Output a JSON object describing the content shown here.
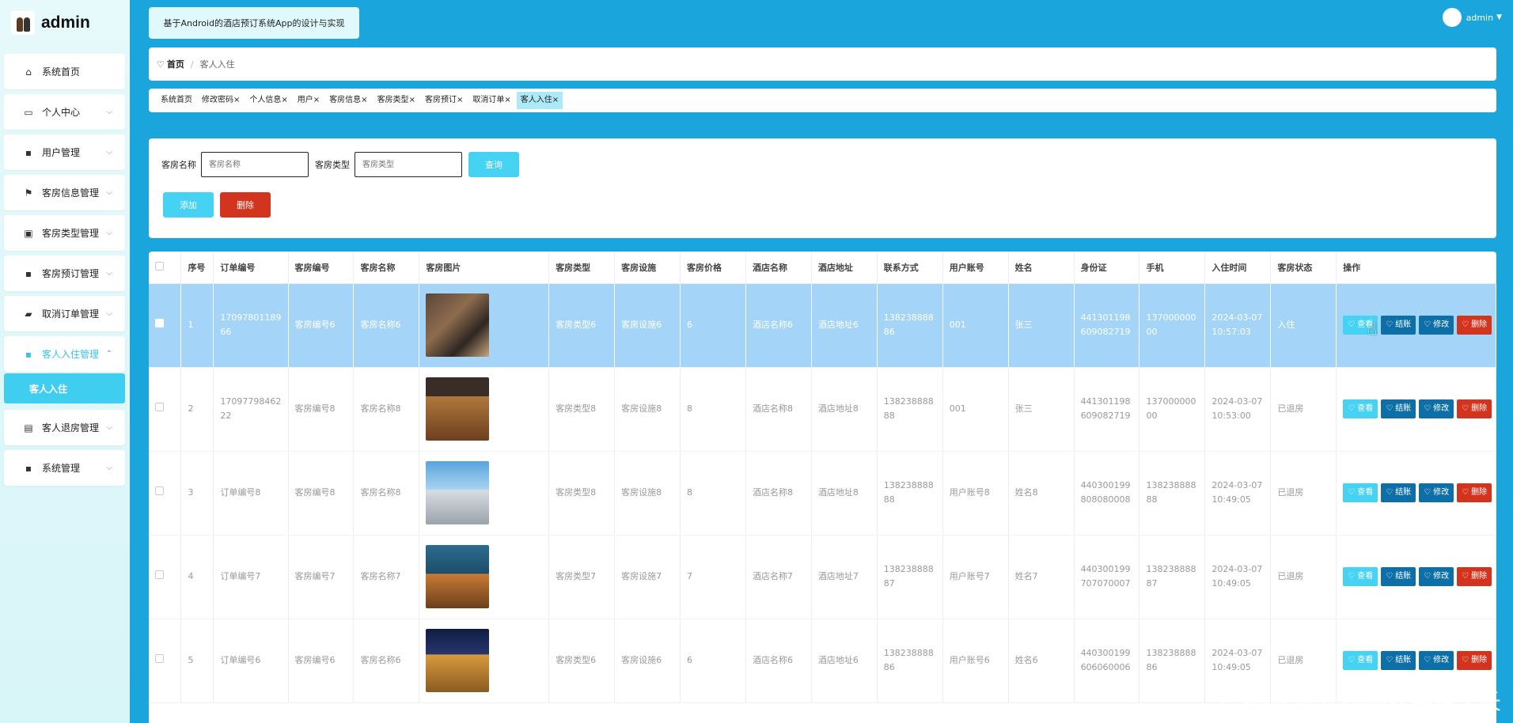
{
  "brand": {
    "title": "admin"
  },
  "sidebar": {
    "items": [
      {
        "label": "系统首页",
        "icon": "home-icon",
        "has_children": false
      },
      {
        "label": "个人中心",
        "icon": "card-icon",
        "has_children": true
      },
      {
        "label": "用户管理",
        "icon": "grid-icon",
        "has_children": true
      },
      {
        "label": "客房信息管理",
        "icon": "flag-icon",
        "has_children": true
      },
      {
        "label": "客房类型管理",
        "icon": "clipboard-icon",
        "has_children": true
      },
      {
        "label": "客房预订管理",
        "icon": "grid-icon",
        "has_children": true
      },
      {
        "label": "取消订单管理",
        "icon": "truck-icon",
        "has_children": true
      },
      {
        "label": "客人入住管理",
        "icon": "grid-icon",
        "has_children": true,
        "expanded": true
      },
      {
        "label": "客人退房管理",
        "icon": "briefcase-icon",
        "has_children": true
      },
      {
        "label": "系统管理",
        "icon": "grid-icon",
        "has_children": true
      }
    ],
    "active_sub": "客人入住"
  },
  "header": {
    "system_title": "基于Android的酒店预订系统App的设计与实现",
    "user": "admin"
  },
  "breadcrumb": {
    "home": "首页",
    "separator": "/",
    "current": "客人入住"
  },
  "tabs": [
    {
      "label": "系统首页",
      "closable": false,
      "active": false
    },
    {
      "label": "修改密码",
      "closable": true,
      "active": false
    },
    {
      "label": "个人信息",
      "closable": true,
      "active": false
    },
    {
      "label": "用户",
      "closable": true,
      "active": false
    },
    {
      "label": "客房信息",
      "closable": true,
      "active": false
    },
    {
      "label": "客房类型",
      "closable": true,
      "active": false
    },
    {
      "label": "客房预订",
      "closable": true,
      "active": false
    },
    {
      "label": "取消订单",
      "closable": true,
      "active": false
    },
    {
      "label": "客人入住",
      "closable": true,
      "active": true
    }
  ],
  "search": {
    "room_name_label": "客房名称",
    "room_name_placeholder": "客房名称",
    "room_type_label": "客房类型",
    "room_type_placeholder": "客房类型",
    "query_button": "查询",
    "add_button": "添加",
    "delete_button": "删除"
  },
  "table": {
    "columns": [
      "序号",
      "订单编号",
      "客房编号",
      "客房名称",
      "客房图片",
      "客房类型",
      "客房设施",
      "客房价格",
      "酒店名称",
      "酒店地址",
      "联系方式",
      "用户账号",
      "姓名",
      "身份证",
      "手机",
      "入住时间",
      "客房状态",
      "操作"
    ],
    "rows": [
      {
        "index": "1",
        "order_no": "1709780118966",
        "room_no": "客房编号6",
        "room_name": "客房名称6",
        "image": "hotel-entrance-photo",
        "room_type": "客房类型6",
        "facility": "客房设施6",
        "price": "6",
        "hotel_name": "酒店名称6",
        "hotel_addr": "酒店地址6",
        "contact": "13823888886",
        "account": "001",
        "name": "张三",
        "id_card": "441301198609082719",
        "phone": "13700000000",
        "checkin_time": "2024-03-07 10:57:03",
        "status": "入住",
        "selected": true
      },
      {
        "index": "2",
        "order_no": "1709779846222",
        "room_no": "客房编号8",
        "room_name": "客房名称8",
        "image": "hotel-facade-photo",
        "room_type": "客房类型8",
        "facility": "客房设施8",
        "price": "8",
        "hotel_name": "酒店名称8",
        "hotel_addr": "酒店地址8",
        "contact": "13823888888",
        "account": "001",
        "name": "张三",
        "id_card": "441301198609082719",
        "phone": "13700000000",
        "checkin_time": "2024-03-07 10:53:00",
        "status": "已退房",
        "selected": false
      },
      {
        "index": "3",
        "order_no": "订单编号8",
        "room_no": "客房编号8",
        "room_name": "客房名称8",
        "image": "hotel-tower-photo",
        "room_type": "客房类型8",
        "facility": "客房设施8",
        "price": "8",
        "hotel_name": "酒店名称8",
        "hotel_addr": "酒店地址8",
        "contact": "13823888888",
        "account": "用户账号8",
        "name": "姓名8",
        "id_card": "440300199808080008",
        "phone": "13823888888",
        "checkin_time": "2024-03-07 10:49:05",
        "status": "已退房",
        "selected": false
      },
      {
        "index": "4",
        "order_no": "订单编号7",
        "room_no": "客房编号7",
        "room_name": "客房名称7",
        "image": "hotel-night-facade-photo",
        "room_type": "客房类型7",
        "facility": "客房设施7",
        "price": "7",
        "hotel_name": "酒店名称7",
        "hotel_addr": "酒店地址7",
        "contact": "13823888887",
        "account": "用户账号7",
        "name": "姓名7",
        "id_card": "440300199707070007",
        "phone": "13823888887",
        "checkin_time": "2024-03-07 10:49:05",
        "status": "已退房",
        "selected": false
      },
      {
        "index": "5",
        "order_no": "订单编号6",
        "room_no": "客房编号6",
        "room_name": "客房名称6",
        "image": "hotel-night-lights-photo",
        "room_type": "客房类型6",
        "facility": "客房设施6",
        "price": "6",
        "hotel_name": "酒店名称6",
        "hotel_addr": "酒店地址6",
        "contact": "13823888886",
        "account": "用户账号6",
        "name": "姓名6",
        "id_card": "440300199606060006",
        "phone": "13823888886",
        "checkin_time": "2024-03-07 10:49:05",
        "status": "已退房",
        "selected": false
      }
    ],
    "actions": {
      "view": "查看",
      "checkout": "结账",
      "edit": "修改",
      "delete": "删除"
    }
  },
  "watermark": "CSDN @计算机程序猿学长",
  "colors": {
    "accent": "#45d2f3",
    "dark_button": "#0c6fa8",
    "danger": "#d2341e",
    "selected_row": "#a4d4f7"
  }
}
